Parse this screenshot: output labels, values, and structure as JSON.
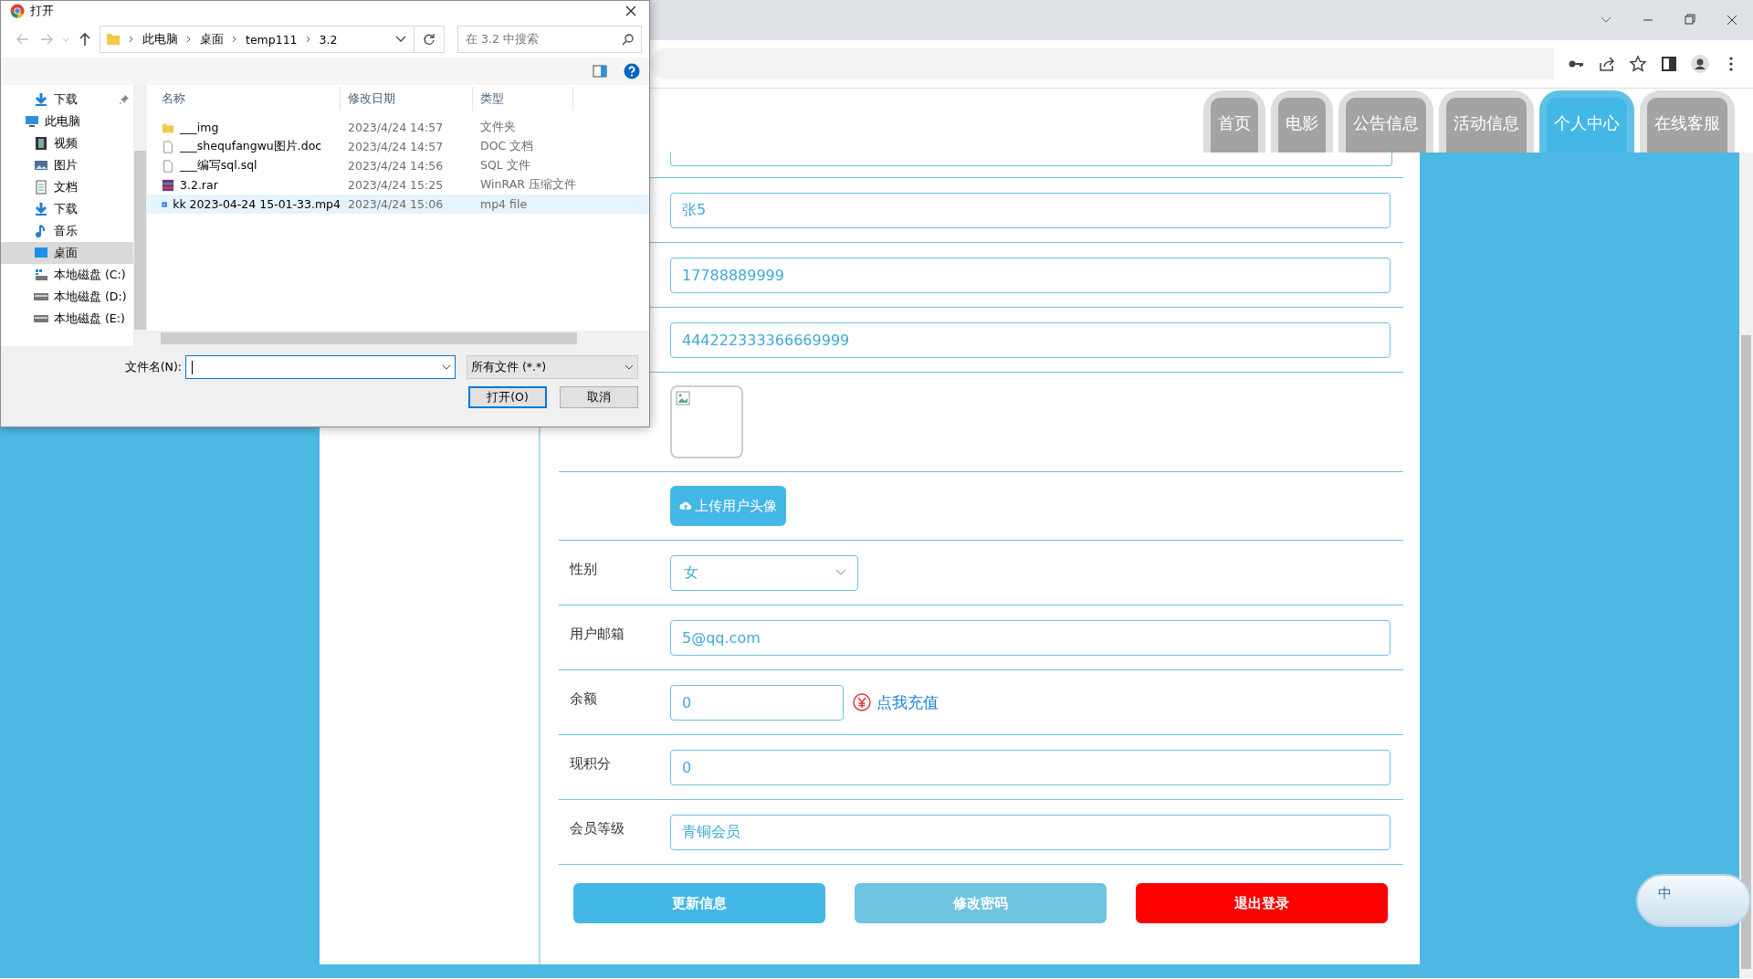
{
  "nav": [
    {
      "label": "首页",
      "selected": false
    },
    {
      "label": "电影",
      "selected": false
    },
    {
      "label": "公告信息",
      "selected": false
    },
    {
      "label": "活动信息",
      "selected": false
    },
    {
      "label": "个人中心",
      "selected": true
    },
    {
      "label": "在线客服",
      "selected": false
    }
  ],
  "profile_form": {
    "rows": [
      {
        "kind": "input",
        "value": "张5"
      },
      {
        "kind": "input",
        "value": "17788889999"
      },
      {
        "kind": "input",
        "value": "444222333366669999"
      },
      {
        "kind": "avatar"
      },
      {
        "kind": "upload",
        "button": "上传用户头像"
      },
      {
        "kind": "select",
        "label": "性别",
        "value": "女"
      },
      {
        "kind": "input",
        "label": "用户邮箱",
        "value": "5@qq.com"
      },
      {
        "kind": "balance",
        "label": "余额",
        "value": "0",
        "link": "点我充值"
      },
      {
        "kind": "input",
        "label": "现积分",
        "value": "0"
      },
      {
        "kind": "input",
        "label": "会员等级",
        "value": "青铜会员"
      }
    ],
    "buttons": [
      {
        "label": "更新信息",
        "kind": "primary"
      },
      {
        "label": "修改密码",
        "kind": "secondary"
      },
      {
        "label": "退出登录",
        "kind": "danger"
      }
    ]
  },
  "open_dialog": {
    "title": "打开",
    "breadcrumb": [
      "此电脑",
      "桌面",
      "temp111",
      "3.2"
    ],
    "search_placeholder": "在 3.2 中搜索",
    "nav_tree": [
      {
        "label": "下载",
        "kind": "download",
        "pinned": true,
        "selected": false
      },
      {
        "label": "此电脑",
        "kind": "pc",
        "pinned": false,
        "selected": false
      },
      {
        "label": "视频",
        "kind": "video",
        "pinned": false,
        "selected": false
      },
      {
        "label": "图片",
        "kind": "picture",
        "pinned": false,
        "selected": false
      },
      {
        "label": "文档",
        "kind": "document",
        "pinned": false,
        "selected": false
      },
      {
        "label": "下载",
        "kind": "download",
        "pinned": false,
        "selected": false
      },
      {
        "label": "音乐",
        "kind": "music",
        "pinned": false,
        "selected": false
      },
      {
        "label": "桌面",
        "kind": "desktop",
        "pinned": false,
        "selected": true
      },
      {
        "label": "本地磁盘 (C:)",
        "kind": "system-drive",
        "pinned": false,
        "selected": false
      },
      {
        "label": "本地磁盘 (D:)",
        "kind": "drive",
        "pinned": false,
        "selected": false
      },
      {
        "label": "本地磁盘 (E:)",
        "kind": "drive",
        "pinned": false,
        "selected": false
      }
    ],
    "columns": [
      "名称",
      "修改日期",
      "类型"
    ],
    "files": [
      {
        "name": "___img",
        "date": "2023/4/24 14:57",
        "type": "文件夹",
        "kind": "folder",
        "selected": false
      },
      {
        "name": "___shequfangwu图片.doc",
        "date": "2023/4/24 14:57",
        "type": "DOC 文档",
        "kind": "file",
        "selected": false
      },
      {
        "name": "___编写sql.sql",
        "date": "2023/4/24 14:56",
        "type": "SQL 文件",
        "kind": "file",
        "selected": false
      },
      {
        "name": "3.2.rar",
        "date": "2023/4/24 15:25",
        "type": "WinRAR 压缩文件",
        "kind": "archive",
        "selected": false
      },
      {
        "name": "kk 2023-04-24 15-01-33.mp4",
        "date": "2023/4/24 15:06",
        "type": "mp4 file",
        "kind": "video",
        "selected": true
      }
    ],
    "filename_label": "文件名(N):",
    "filetype": "所有文件 (*.*)",
    "buttons": [
      {
        "label": "打开(O)",
        "kind": "default"
      },
      {
        "label": "取消",
        "kind": "normal"
      }
    ]
  },
  "ime": {
    "label": "中"
  }
}
